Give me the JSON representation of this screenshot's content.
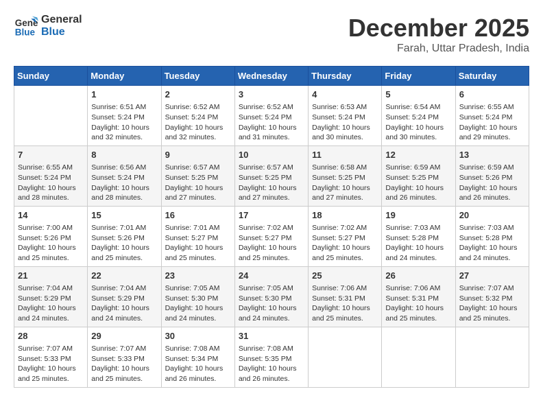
{
  "header": {
    "logo_line1": "General",
    "logo_line2": "Blue",
    "title": "December 2025",
    "subtitle": "Farah, Uttar Pradesh, India"
  },
  "days_of_week": [
    "Sunday",
    "Monday",
    "Tuesday",
    "Wednesday",
    "Thursday",
    "Friday",
    "Saturday"
  ],
  "weeks": [
    [
      {
        "day": "",
        "empty": true
      },
      {
        "day": "1",
        "sunrise": "6:51 AM",
        "sunset": "5:24 PM",
        "daylight": "10 hours and 32 minutes."
      },
      {
        "day": "2",
        "sunrise": "6:52 AM",
        "sunset": "5:24 PM",
        "daylight": "10 hours and 32 minutes."
      },
      {
        "day": "3",
        "sunrise": "6:52 AM",
        "sunset": "5:24 PM",
        "daylight": "10 hours and 31 minutes."
      },
      {
        "day": "4",
        "sunrise": "6:53 AM",
        "sunset": "5:24 PM",
        "daylight": "10 hours and 30 minutes."
      },
      {
        "day": "5",
        "sunrise": "6:54 AM",
        "sunset": "5:24 PM",
        "daylight": "10 hours and 30 minutes."
      },
      {
        "day": "6",
        "sunrise": "6:55 AM",
        "sunset": "5:24 PM",
        "daylight": "10 hours and 29 minutes."
      }
    ],
    [
      {
        "day": "7",
        "sunrise": "6:55 AM",
        "sunset": "5:24 PM",
        "daylight": "10 hours and 28 minutes."
      },
      {
        "day": "8",
        "sunrise": "6:56 AM",
        "sunset": "5:24 PM",
        "daylight": "10 hours and 28 minutes."
      },
      {
        "day": "9",
        "sunrise": "6:57 AM",
        "sunset": "5:25 PM",
        "daylight": "10 hours and 27 minutes."
      },
      {
        "day": "10",
        "sunrise": "6:57 AM",
        "sunset": "5:25 PM",
        "daylight": "10 hours and 27 minutes."
      },
      {
        "day": "11",
        "sunrise": "6:58 AM",
        "sunset": "5:25 PM",
        "daylight": "10 hours and 27 minutes."
      },
      {
        "day": "12",
        "sunrise": "6:59 AM",
        "sunset": "5:25 PM",
        "daylight": "10 hours and 26 minutes."
      },
      {
        "day": "13",
        "sunrise": "6:59 AM",
        "sunset": "5:26 PM",
        "daylight": "10 hours and 26 minutes."
      }
    ],
    [
      {
        "day": "14",
        "sunrise": "7:00 AM",
        "sunset": "5:26 PM",
        "daylight": "10 hours and 25 minutes."
      },
      {
        "day": "15",
        "sunrise": "7:01 AM",
        "sunset": "5:26 PM",
        "daylight": "10 hours and 25 minutes."
      },
      {
        "day": "16",
        "sunrise": "7:01 AM",
        "sunset": "5:27 PM",
        "daylight": "10 hours and 25 minutes."
      },
      {
        "day": "17",
        "sunrise": "7:02 AM",
        "sunset": "5:27 PM",
        "daylight": "10 hours and 25 minutes."
      },
      {
        "day": "18",
        "sunrise": "7:02 AM",
        "sunset": "5:27 PM",
        "daylight": "10 hours and 25 minutes."
      },
      {
        "day": "19",
        "sunrise": "7:03 AM",
        "sunset": "5:28 PM",
        "daylight": "10 hours and 24 minutes."
      },
      {
        "day": "20",
        "sunrise": "7:03 AM",
        "sunset": "5:28 PM",
        "daylight": "10 hours and 24 minutes."
      }
    ],
    [
      {
        "day": "21",
        "sunrise": "7:04 AM",
        "sunset": "5:29 PM",
        "daylight": "10 hours and 24 minutes."
      },
      {
        "day": "22",
        "sunrise": "7:04 AM",
        "sunset": "5:29 PM",
        "daylight": "10 hours and 24 minutes."
      },
      {
        "day": "23",
        "sunrise": "7:05 AM",
        "sunset": "5:30 PM",
        "daylight": "10 hours and 24 minutes."
      },
      {
        "day": "24",
        "sunrise": "7:05 AM",
        "sunset": "5:30 PM",
        "daylight": "10 hours and 24 minutes."
      },
      {
        "day": "25",
        "sunrise": "7:06 AM",
        "sunset": "5:31 PM",
        "daylight": "10 hours and 25 minutes."
      },
      {
        "day": "26",
        "sunrise": "7:06 AM",
        "sunset": "5:31 PM",
        "daylight": "10 hours and 25 minutes."
      },
      {
        "day": "27",
        "sunrise": "7:07 AM",
        "sunset": "5:32 PM",
        "daylight": "10 hours and 25 minutes."
      }
    ],
    [
      {
        "day": "28",
        "sunrise": "7:07 AM",
        "sunset": "5:33 PM",
        "daylight": "10 hours and 25 minutes."
      },
      {
        "day": "29",
        "sunrise": "7:07 AM",
        "sunset": "5:33 PM",
        "daylight": "10 hours and 25 minutes."
      },
      {
        "day": "30",
        "sunrise": "7:08 AM",
        "sunset": "5:34 PM",
        "daylight": "10 hours and 26 minutes."
      },
      {
        "day": "31",
        "sunrise": "7:08 AM",
        "sunset": "5:35 PM",
        "daylight": "10 hours and 26 minutes."
      },
      {
        "day": "",
        "empty": true
      },
      {
        "day": "",
        "empty": true
      },
      {
        "day": "",
        "empty": true
      }
    ]
  ],
  "labels": {
    "sunrise_prefix": "Sunrise: ",
    "sunset_prefix": "Sunset: ",
    "daylight_prefix": "Daylight: "
  }
}
